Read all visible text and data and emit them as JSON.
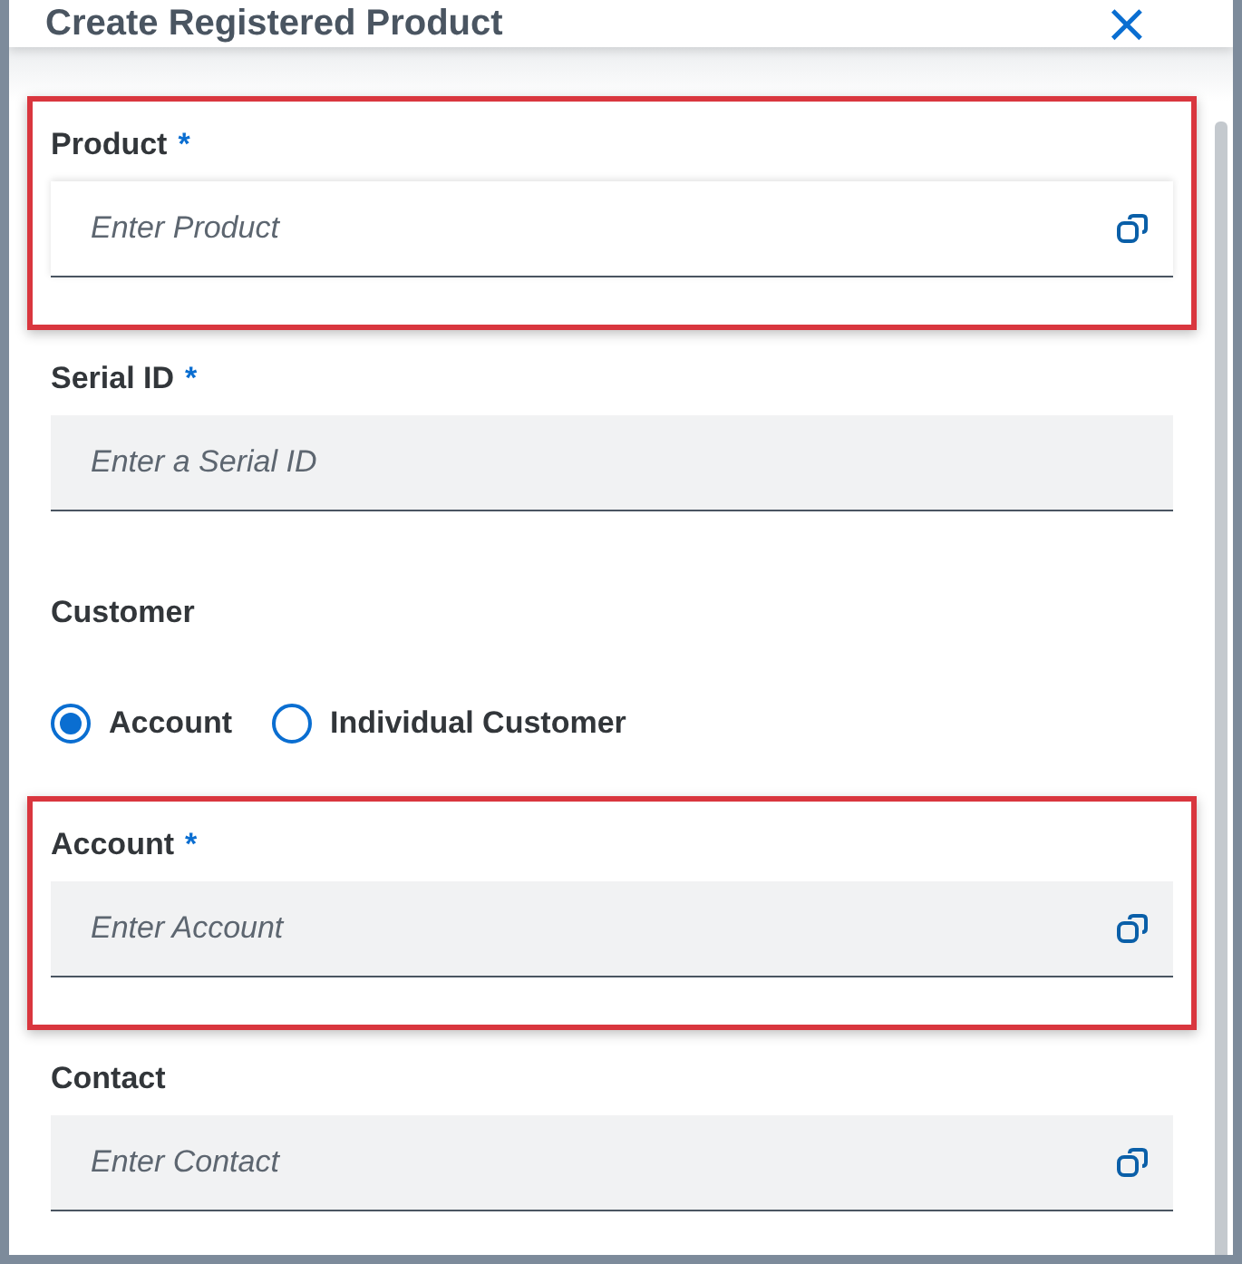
{
  "dialog": {
    "title": "Create Registered Product",
    "close": "×"
  },
  "fields": [
    {
      "kind": "input",
      "label": "Product",
      "required_mark": "*",
      "placeholder": "Enter Product",
      "value_help": true,
      "highlighted": true,
      "focused": true
    },
    {
      "kind": "input",
      "label": "Serial ID",
      "required_mark": "*",
      "placeholder": "Enter a Serial ID",
      "highlighted": false,
      "focused": false
    },
    {
      "kind": "radio-group",
      "label": "Customer",
      "highlighted": false,
      "options": [
        {
          "label": "Account",
          "selected": true
        },
        {
          "label": "Individual Customer",
          "selected": false
        }
      ]
    },
    {
      "kind": "input",
      "label": "Account",
      "required_mark": "*",
      "placeholder": "Enter Account",
      "value_help": true,
      "highlighted": true,
      "focused": false
    },
    {
      "kind": "input",
      "label": "Contact",
      "placeholder": "Enter Contact",
      "value_help": true,
      "highlighted": false,
      "focused": false
    }
  ]
}
